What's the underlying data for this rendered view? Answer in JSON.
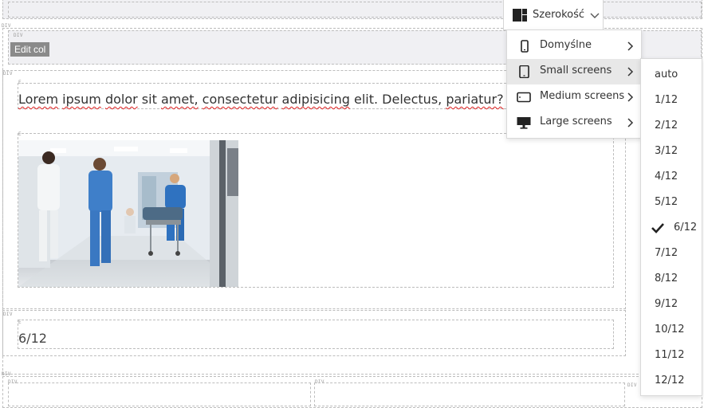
{
  "toolbar": {
    "width_button_label": "Szerokość",
    "width_icon": "layout-columns-icon",
    "chevron_icon": "chevron-down-icon"
  },
  "editor": {
    "div_tag": "DIV",
    "edit_col_label": "Edit col",
    "paragraph_text_parts": [
      "Lorem",
      "ipsum",
      "dolor",
      "sit",
      "amet,",
      "consectetur",
      "adipisicing",
      "elit.",
      "Delectus,",
      "pariatur?"
    ],
    "misspelled_words": [
      "Lorem",
      "ipsum",
      "dolor",
      "amet,",
      "consectetur",
      "adipisicing",
      "pariatur?"
    ],
    "image_alt": "hospital corridor with medical staff",
    "width_value_text": "6/12"
  },
  "width_menu": {
    "items": [
      {
        "label": "Domyślne",
        "icon": "phone-icon",
        "active": false
      },
      {
        "label": "Small screens",
        "icon": "tablet-icon",
        "active": true
      },
      {
        "label": "Medium screens",
        "icon": "tablet-landscape-icon",
        "active": false
      },
      {
        "label": "Large screens",
        "icon": "monitor-icon",
        "active": false
      }
    ]
  },
  "sizes_submenu": {
    "items": [
      "auto",
      "1/12",
      "2/12",
      "3/12",
      "4/12",
      "5/12",
      "6/12",
      "7/12",
      "8/12",
      "9/12",
      "10/12",
      "11/12",
      "12/12"
    ],
    "selected": "6/12"
  },
  "colors": {
    "active_item_bg": "#e8e8e8",
    "edit_col_bg": "#8a8a8a",
    "spellcheck_underline": "#e02020"
  }
}
